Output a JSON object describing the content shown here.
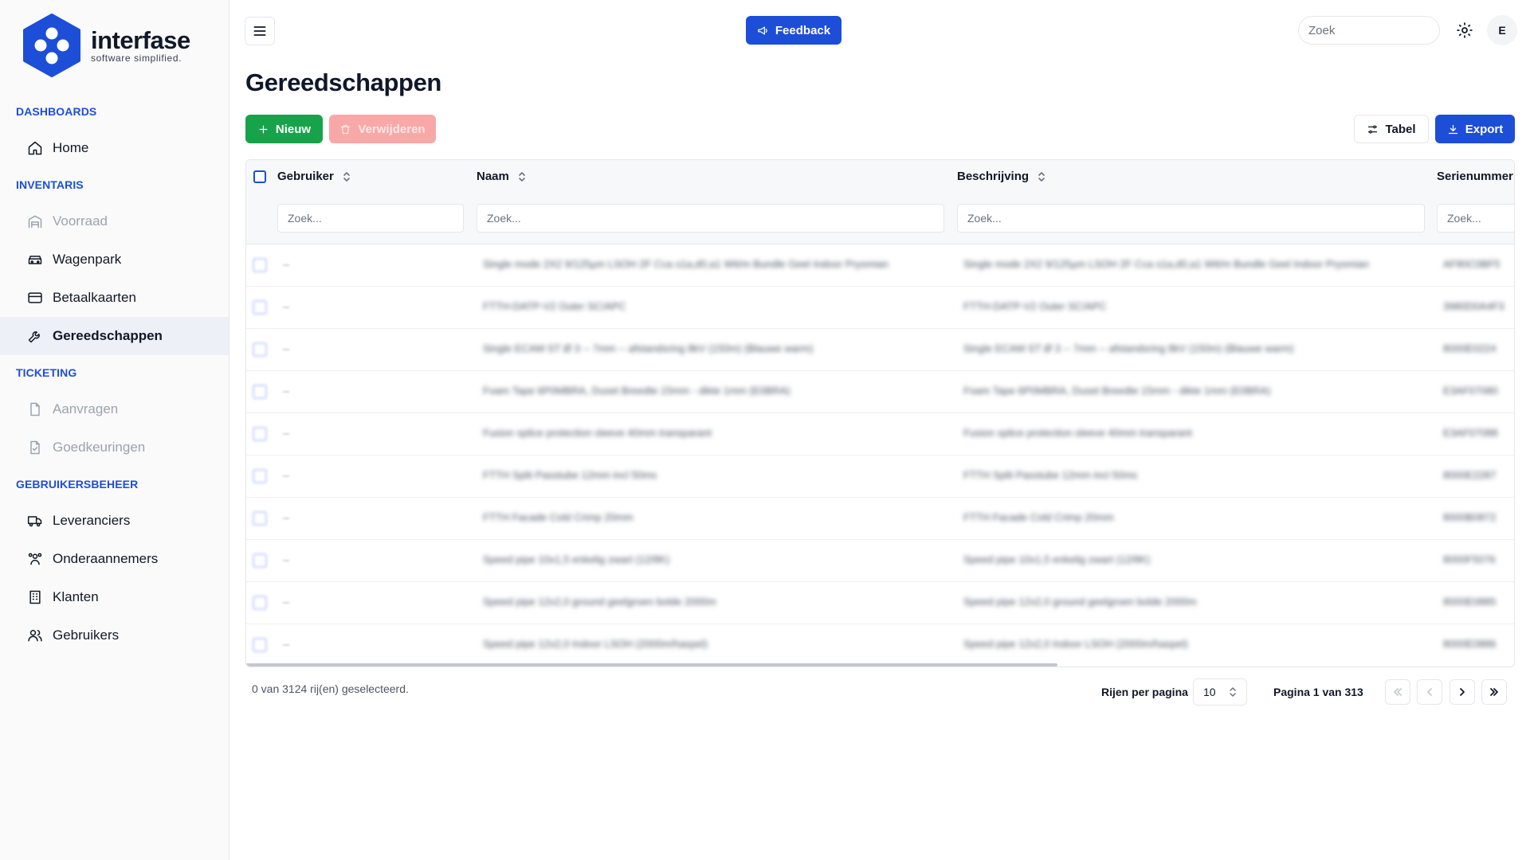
{
  "brand": {
    "name": "interfase",
    "tagline": "software simplified.",
    "accent": "#1d4ed8"
  },
  "sidebar": {
    "sections": [
      {
        "title": "DASHBOARDS",
        "items": [
          {
            "label": "Home",
            "icon": "home-icon",
            "enabled": true,
            "active": false
          }
        ]
      },
      {
        "title": "INVENTARIS",
        "items": [
          {
            "label": "Voorraad",
            "icon": "warehouse-icon",
            "enabled": false,
            "active": false
          },
          {
            "label": "Wagenpark",
            "icon": "car-icon",
            "enabled": true,
            "active": false
          },
          {
            "label": "Betaalkaarten",
            "icon": "credit-card-icon",
            "enabled": true,
            "active": false
          },
          {
            "label": "Gereedschappen",
            "icon": "wrench-icon",
            "enabled": true,
            "active": true
          }
        ]
      },
      {
        "title": "TICKETING",
        "items": [
          {
            "label": "Aanvragen",
            "icon": "file-icon",
            "enabled": false,
            "active": false
          },
          {
            "label": "Goedkeuringen",
            "icon": "file-check-icon",
            "enabled": false,
            "active": false
          }
        ]
      },
      {
        "title": "GEBRUIKERSBEHEER",
        "items": [
          {
            "label": "Leveranciers",
            "icon": "truck-icon",
            "enabled": true,
            "active": false
          },
          {
            "label": "Onderaannemers",
            "icon": "users-group-icon",
            "enabled": true,
            "active": false
          },
          {
            "label": "Klanten",
            "icon": "building-icon",
            "enabled": true,
            "active": false
          },
          {
            "label": "Gebruikers",
            "icon": "users-icon",
            "enabled": true,
            "active": false
          }
        ]
      }
    ]
  },
  "topbar": {
    "feedback_label": "Feedback",
    "search_placeholder": "Zoek",
    "avatar_initial": "E"
  },
  "page": {
    "title": "Gereedschappen",
    "new_label": "Nieuw",
    "delete_label": "Verwijderen",
    "table_view_label": "Tabel",
    "export_label": "Export"
  },
  "table": {
    "columns": [
      "Gebruiker",
      "Naam",
      "Beschrijving",
      "Serienummer"
    ],
    "filter_placeholder": "Zoek...",
    "rows": [
      {
        "naam": "Single mode 2X2 9/125µm LSOH 2F Cca s1a,d0,a1 Wit/m Bundle Geel Indoor Prysmian",
        "beschrijving": "Single mode 2X2 9/125µm LSOH 2F Cca s1a,d0,a1 Wit/m Bundle Geel Indoor Prysmian",
        "serienummer": "AF80C0BF5"
      },
      {
        "naam": "FTTH-DATP-V2 Outer SC/APC",
        "beschrijving": "FTTH-DATP-V2 Outer SC/APC",
        "serienummer": "3980D0A4F3"
      },
      {
        "naam": "Single ECAM ST Ø 3 -- 7mm -- afstandsring 8kV (150m) (Blauwe warm)",
        "beschrijving": "Single ECAM ST Ø 3 -- 7mm -- afstandsring 8kV (150m) (Blauwe warm)",
        "serienummer": "8000E0224"
      },
      {
        "naam": "Foam Tape 6P0MBRA, Duset Breedte 15mm - dikte 1mm (E0BRA)",
        "beschrijving": "Foam Tape 6P0MBRA, Duset Breedte 15mm - dikte 1mm (E0BRA)",
        "serienummer": "E3AF07080"
      },
      {
        "naam": "Fusion splice protection sleeve 40mm transparant",
        "beschrijving": "Fusion splice protection sleeve 40mm transparant",
        "serienummer": "E3AF07088"
      },
      {
        "naam": "FTTH Split Passtube 12mm incl 50ms",
        "beschrijving": "FTTH Split Passtube 12mm incl 50ms",
        "serienummer": "8000E2287"
      },
      {
        "naam": "FTTH Facade Cold Crimp 20mm",
        "beschrijving": "FTTH Facade Cold Crimp 20mm",
        "serienummer": "8000B0872"
      },
      {
        "naam": "Speed pipe 10x1,5 enkelig zwart (12/8K)",
        "beschrijving": "Speed pipe 10x1,5 enkelig zwart (12/8K)",
        "serienummer": "8000F5076"
      },
      {
        "naam": "Speed pipe 12x2,0 ground geelgroen bolde 2000m",
        "beschrijving": "Speed pipe 12x2,0 ground geelgroen bolde 2000m",
        "serienummer": "8000E0885"
      },
      {
        "naam": "Speed pipe 12x2,0 Indoor LSOH (2000m/haspel)",
        "beschrijving": "Speed pipe 12x2,0 Indoor LSOH (2000m/haspel)",
        "serienummer": "8000E0886"
      }
    ]
  },
  "pagination": {
    "selected_info": "0 van 3124 rij(en) geselecteerd.",
    "rows_per_page_label": "Rijen per pagina",
    "rows_per_page_value": "10",
    "page_info": "Pagina 1 van 313"
  }
}
